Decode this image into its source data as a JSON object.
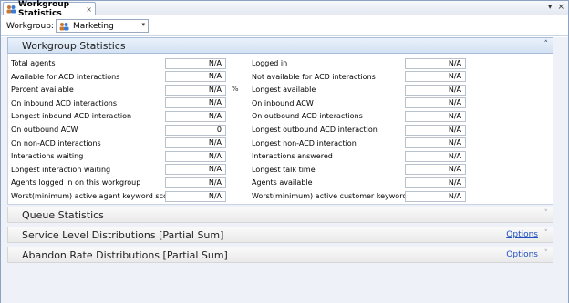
{
  "tab": {
    "title": "Workgroup Statistics",
    "close_glyph": "×"
  },
  "window_controls": {
    "dropdown": "▾",
    "close": "×"
  },
  "toolbar": {
    "workgroup_label": "Workgroup:",
    "workgroup_value": "Marketing",
    "dropdown_arrow": "▾"
  },
  "panels": [
    {
      "title": "Workgroup Statistics",
      "state": "expanded",
      "chevron": "˄"
    },
    {
      "title": "Queue Statistics",
      "state": "collapsed",
      "chevron": "˅"
    },
    {
      "title": "Service Level Distributions [Partial Sum]",
      "state": "collapsed",
      "chevron": "˅",
      "options": "Options"
    },
    {
      "title": "Abandon Rate Distributions [Partial Sum]",
      "state": "collapsed",
      "chevron": "˅",
      "options": "Options"
    }
  ],
  "left_stats": [
    {
      "label": "Total agents",
      "value": "N/A"
    },
    {
      "label": "Available for ACD interactions",
      "value": "N/A"
    },
    {
      "label": "Percent available",
      "value": "N/A",
      "unit": "%"
    },
    {
      "label": "On inbound ACD interactions",
      "value": "N/A"
    },
    {
      "label": "Longest inbound ACD interaction",
      "value": "N/A"
    },
    {
      "label": "On outbound ACW",
      "value": "0"
    },
    {
      "label": "On non-ACD interactions",
      "value": "N/A"
    },
    {
      "label": "Interactions waiting",
      "value": "N/A"
    },
    {
      "label": "Longest interaction waiting",
      "value": "N/A"
    },
    {
      "label": "Agents logged in on this workgroup",
      "value": "N/A"
    },
    {
      "label": "Worst(minimum) active agent keyword score",
      "value": "N/A"
    }
  ],
  "right_stats": [
    {
      "label": "Logged in",
      "value": "N/A"
    },
    {
      "label": "Not available for ACD interactions",
      "value": "N/A"
    },
    {
      "label": "Longest available",
      "value": "N/A"
    },
    {
      "label": "On inbound ACW",
      "value": "N/A"
    },
    {
      "label": "On outbound ACD interactions",
      "value": "N/A"
    },
    {
      "label": "Longest outbound ACD interaction",
      "value": "N/A"
    },
    {
      "label": "Longest non-ACD interaction",
      "value": "N/A"
    },
    {
      "label": "Interactions answered",
      "value": "N/A"
    },
    {
      "label": "Longest talk time",
      "value": "N/A"
    },
    {
      "label": "Agents available",
      "value": "N/A"
    },
    {
      "label": "Worst(minimum) active customer keyword score",
      "value": "N/A"
    }
  ],
  "colors": {
    "panel_header_active": "#d4e2f3",
    "link": "#1f4fbf",
    "border": "#a9bcd8"
  }
}
